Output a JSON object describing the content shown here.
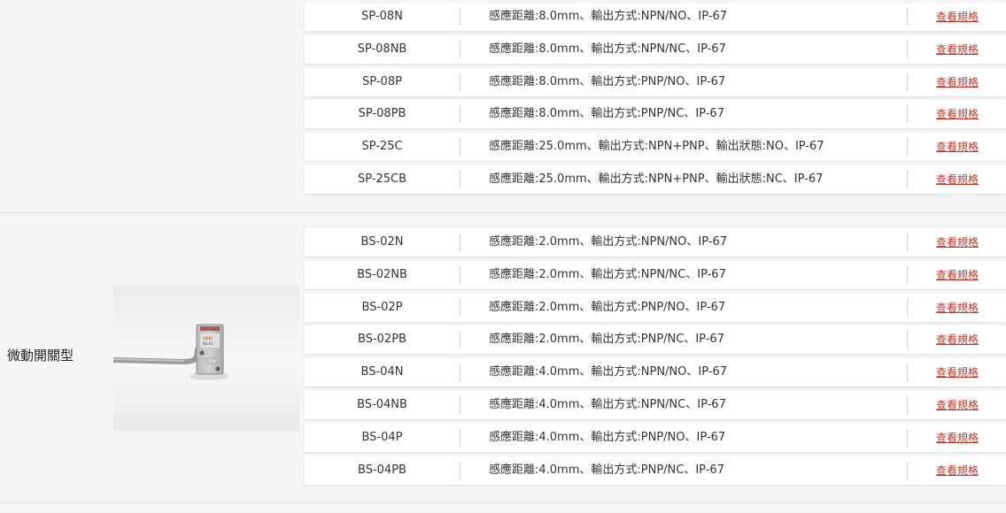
{
  "groups": [
    {
      "name": "",
      "rows": [
        {
          "model": "SP-08N",
          "desc": "感應距離:8.0mm、輸出方式:NPN/NO、IP-67",
          "link": "查看規格"
        },
        {
          "model": "SP-08NB",
          "desc": "感應距離:8.0mm、輸出方式:NPN/NC、IP-67",
          "link": "查看規格"
        },
        {
          "model": "SP-08P",
          "desc": "感應距離:8.0mm、輸出方式:PNP/NO、IP-67",
          "link": "查看規格"
        },
        {
          "model": "SP-08PB",
          "desc": "感應距離:8.0mm、輸出方式:PNP/NC、IP-67",
          "link": "查看規格"
        },
        {
          "model": "SP-25C",
          "desc": "感應距離:25.0mm、輸出方式:NPN+PNP、輸出狀態:NO、IP-67",
          "link": "查看規格"
        },
        {
          "model": "SP-25CB",
          "desc": "感應距離:25.0mm、輸出方式:NPN+PNP、輸出狀態:NC、IP-67",
          "link": "查看規格"
        }
      ]
    },
    {
      "name": "微動開關型",
      "image": "micro-switch-sensor-photo",
      "rows": [
        {
          "model": "BS-02N",
          "desc": "感應距離:2.0mm、輸出方式:NPN/NO、IP-67",
          "link": "查看規格"
        },
        {
          "model": "BS-02NB",
          "desc": "感應距離:2.0mm、輸出方式:NPN/NC、IP-67",
          "link": "查看規格"
        },
        {
          "model": "BS-02P",
          "desc": "感應距離:2.0mm、輸出方式:PNP/NO、IP-67",
          "link": "查看規格"
        },
        {
          "model": "BS-02PB",
          "desc": "感應距離:2.0mm、輸出方式:PNP/NC、IP-67",
          "link": "查看規格"
        },
        {
          "model": "BS-04N",
          "desc": "感應距離:4.0mm、輸出方式:NPN/NO、IP-67",
          "link": "查看規格"
        },
        {
          "model": "BS-04NB",
          "desc": "感應距離:4.0mm、輸出方式:NPN/NC、IP-67",
          "link": "查看規格"
        },
        {
          "model": "BS-04P",
          "desc": "感應距離:4.0mm、輸出方式:PNP/NO、IP-67",
          "link": "查看規格"
        },
        {
          "model": "BS-04PB",
          "desc": "感應距離:4.0mm、輸出方式:PNP/NC、IP-67",
          "link": "查看規格"
        }
      ]
    }
  ],
  "colors": {
    "link": "#c0392b",
    "page_bg": "#f4f5f7",
    "row_bg": "#ffffff"
  }
}
